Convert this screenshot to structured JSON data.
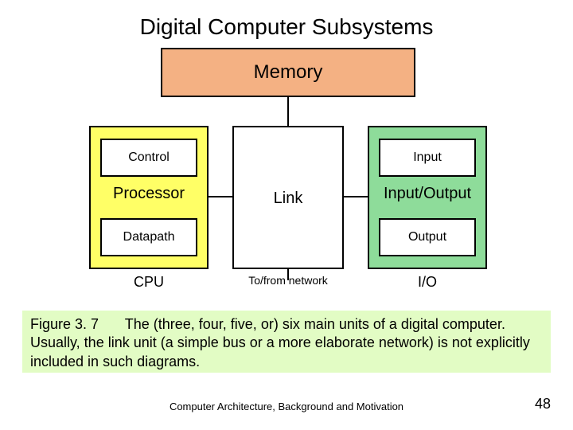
{
  "title": "Digital Computer Subsystems",
  "diagram": {
    "memory": "Memory",
    "processor": {
      "label": "Processor",
      "top": "Control",
      "bottom": "Datapath",
      "under": "CPU"
    },
    "link": {
      "label": "Link",
      "under": "To/from network"
    },
    "io": {
      "label": "Input/Output",
      "top": "Input",
      "bottom": "Output",
      "under": "I/O"
    }
  },
  "caption": {
    "figure_id": "Figure 3. 7",
    "text": "The (three, four, five, or) six main units of a digital computer. Usually, the link unit (a simple bus or a more elaborate network) is not explicitly included in such diagrams."
  },
  "footer": {
    "center": "Computer Architecture, Background and Motivation",
    "page": "48"
  }
}
